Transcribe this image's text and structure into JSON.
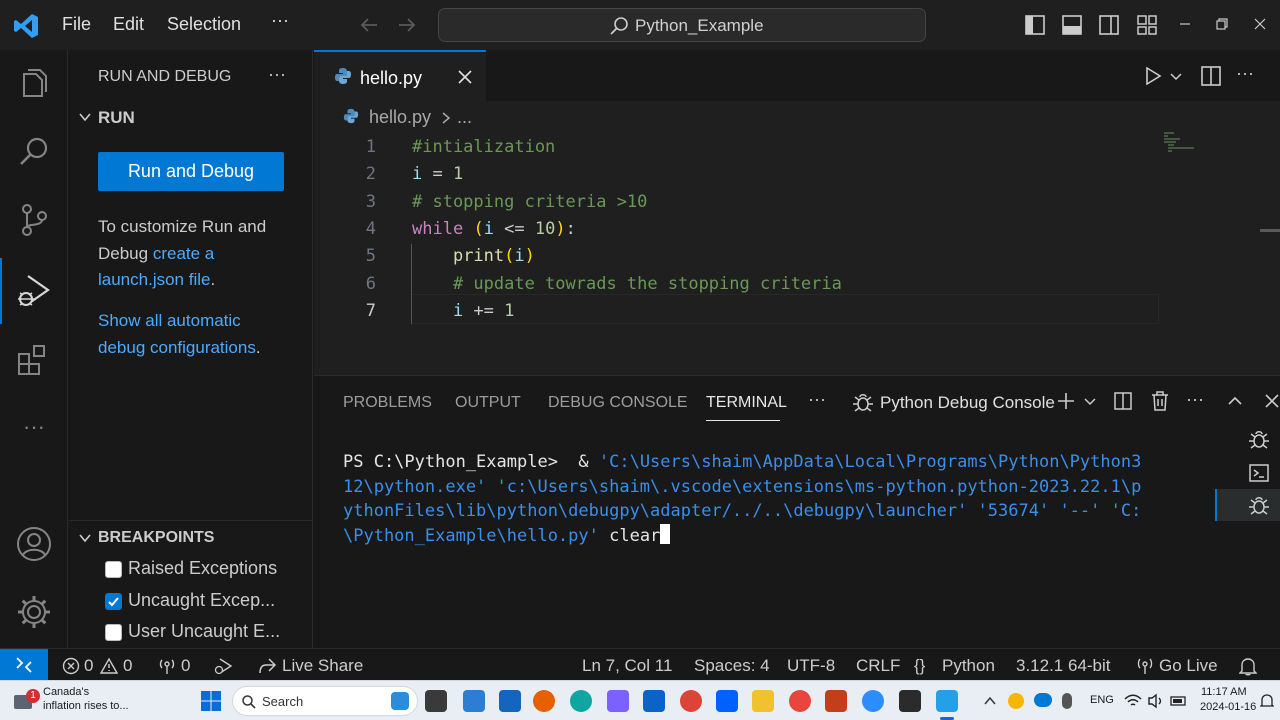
{
  "titlebar": {
    "menu": [
      "File",
      "Edit",
      "Selection"
    ],
    "more": "···",
    "search_text": "Python_Example"
  },
  "sidebar": {
    "title": "RUN AND DEBUG",
    "more": "···",
    "run_section": "RUN",
    "run_button": "Run and Debug",
    "customize_text_1": "To customize Run and",
    "customize_text_2": "Debug ",
    "customize_link_1": "create a",
    "customize_link_2": "launch.json file",
    "customize_suffix": ".",
    "show_all_link_1": "Show all automatic",
    "show_all_link_2": "debug configurations",
    "show_all_suffix": ".",
    "breakpoints_section": "BREAKPOINTS",
    "breakpoints": [
      {
        "label": "Raised Exceptions",
        "checked": false
      },
      {
        "label": "Uncaught Excep...",
        "checked": true
      },
      {
        "label": "User Uncaught E...",
        "checked": false
      }
    ]
  },
  "editor": {
    "tab_label": "hello.py",
    "breadcrumb_file": "hello.py",
    "breadcrumb_more": "...",
    "line_numbers": [
      "1",
      "2",
      "3",
      "4",
      "5",
      "6",
      "7"
    ],
    "lines": [
      "#intialization",
      "i = 1",
      "# stopping criteria >10",
      "while (i <= 10):",
      "    print(i)",
      "    # update towrads the stopping criteria",
      "    i += 1"
    ]
  },
  "panel": {
    "tabs": [
      "PROBLEMS",
      "OUTPUT",
      "DEBUG CONSOLE",
      "TERMINAL"
    ],
    "active_tab": "TERMINAL",
    "more": "···",
    "terminal_name": "Python Debug Console",
    "terminal": {
      "prompt": "PS C:\\Python_Example>  & ",
      "line1_blue": "'C:\\Users\\shaim\\AppData\\Local\\Programs\\Python\\Python3",
      "line2": "12\\python.exe' 'c:\\Users\\shaim\\.vscode\\extensions\\ms-python.python-2023.22.1\\p",
      "line3": "ythonFiles\\lib\\python\\debugpy\\adapter/../..\\debugpy\\launcher' '53674' '--' 'C:",
      "line4_blue": "\\Python_Example\\hello.py'",
      "command": " clear"
    }
  },
  "statusbar": {
    "errors": "0",
    "warnings": "0",
    "ports": "0",
    "live_share": "Live Share",
    "position": "Ln 7, Col 11",
    "spaces": "Spaces: 4",
    "encoding": "UTF-8",
    "eol": "CRLF",
    "language": "Python",
    "interpreter": "3.12.1 64-bit",
    "go_live": "Go Live"
  },
  "taskbar": {
    "news_badge": "1",
    "news_line1": "Canada's",
    "news_line2": "inflation rises to...",
    "search": "Search",
    "lang": "ENG",
    "time": "11:17 AM",
    "date": "2024-01-16"
  },
  "colors": {
    "accent": "#0078d4",
    "link": "#4daafc",
    "editor_bg": "#1f1f1f",
    "sidebar_bg": "#181818"
  }
}
